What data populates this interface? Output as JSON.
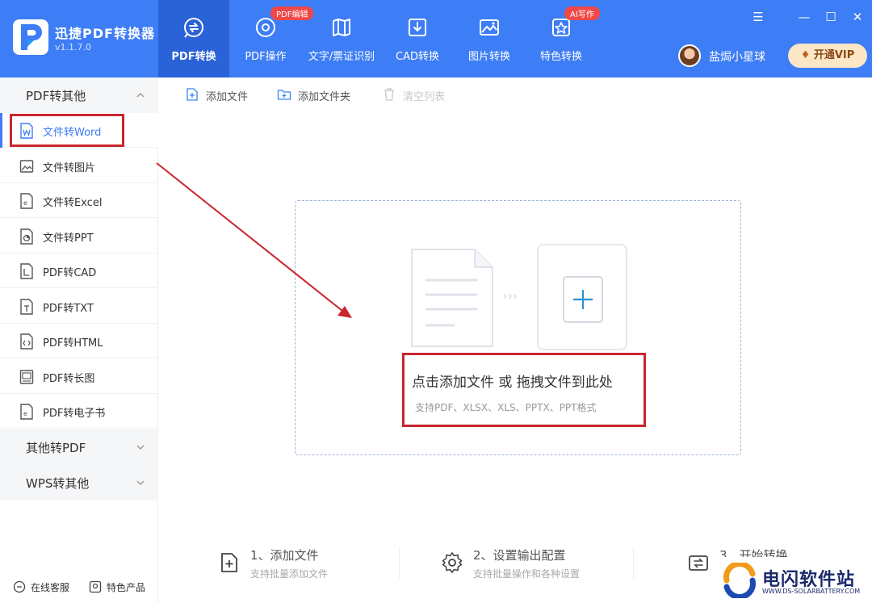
{
  "app": {
    "name": "迅捷PDF转换器",
    "version": "v1.1.7.0"
  },
  "nav_tabs": [
    {
      "label": "PDF转换",
      "icon": "pdf-convert-icon",
      "active": true
    },
    {
      "label": "PDF操作",
      "icon": "pdf-operate-icon",
      "badge": "PDF编辑"
    },
    {
      "label": "文字/票证识别",
      "icon": "ocr-icon"
    },
    {
      "label": "CAD转换",
      "icon": "cad-icon"
    },
    {
      "label": "图片转换",
      "icon": "image-icon"
    },
    {
      "label": "特色转换",
      "icon": "feature-icon",
      "badge": "AI写作"
    }
  ],
  "user": {
    "name": "盐焗小星球",
    "vip_label": "开通VIP"
  },
  "sidebar": {
    "groups": [
      {
        "label": "PDF转其他",
        "expanded": true
      },
      {
        "label": "其他转PDF",
        "expanded": false
      },
      {
        "label": "WPS转其他",
        "expanded": false
      }
    ],
    "items": [
      {
        "label": "文件转Word",
        "icon": "word-file-icon",
        "active": true
      },
      {
        "label": "文件转图片",
        "icon": "image-file-icon"
      },
      {
        "label": "文件转Excel",
        "icon": "excel-file-icon"
      },
      {
        "label": "文件转PPT",
        "icon": "ppt-file-icon"
      },
      {
        "label": "PDF转CAD",
        "icon": "cad-file-icon"
      },
      {
        "label": "PDF转TXT",
        "icon": "txt-file-icon"
      },
      {
        "label": "PDF转HTML",
        "icon": "html-file-icon"
      },
      {
        "label": "PDF转长图",
        "icon": "long-image-icon"
      },
      {
        "label": "PDF转电子书",
        "icon": "ebook-icon"
      }
    ],
    "footer": {
      "service": "在线客服",
      "products": "特色产品"
    }
  },
  "toolbar": {
    "add_file": "添加文件",
    "add_folder": "添加文件夹",
    "clear_list": "清空列表"
  },
  "dropzone": {
    "title": "点击添加文件 或 拖拽文件到此处",
    "subtitle": "支持PDF、XLSX、XLS、PPTX、PPT格式",
    "arrows": "›››"
  },
  "steps": [
    {
      "title": "1、添加文件",
      "subtitle": "支持批量添加文件",
      "icon": "add-file-icon"
    },
    {
      "title": "2、设置输出配置",
      "subtitle": "支持批量操作和各种设置",
      "icon": "settings-gear-icon"
    },
    {
      "title": "3、开始转换",
      "subtitle": "",
      "icon": "convert-icon"
    }
  ],
  "watermark": {
    "title": "电闪软件站",
    "url": "WWW.DS-SOLARBATTERY.COM"
  },
  "colors": {
    "brand": "#3d7df5",
    "annotation": "#c9262e",
    "badge": "#f04848"
  }
}
